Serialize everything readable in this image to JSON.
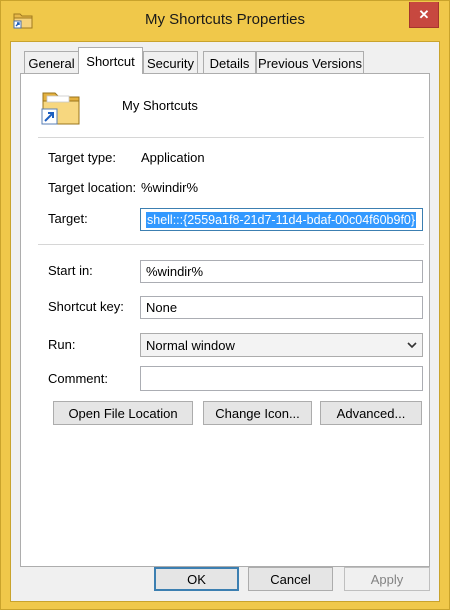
{
  "window": {
    "title": "My Shortcuts Properties",
    "close_glyph": "✕"
  },
  "tabs": [
    {
      "label": "General"
    },
    {
      "label": "Shortcut"
    },
    {
      "label": "Security"
    },
    {
      "label": "Details"
    },
    {
      "label": "Previous Versions"
    }
  ],
  "active_tab": "Shortcut",
  "shortcut": {
    "name": "My Shortcuts",
    "target_type_label": "Target type:",
    "target_type_value": "Application",
    "target_location_label": "Target location:",
    "target_location_value": "%windir%",
    "target_label": "Target:",
    "target_value": "shell:::{2559a1f8-21d7-11d4-bdaf-00c04f60b9f0}",
    "start_in_label": "Start in:",
    "start_in_value": "%windir%",
    "shortcut_key_label": "Shortcut key:",
    "shortcut_key_value": "None",
    "run_label": "Run:",
    "run_value": "Normal window",
    "comment_label": "Comment:",
    "comment_value": "",
    "open_file_location_label": "Open File Location",
    "change_icon_label": "Change Icon...",
    "advanced_label": "Advanced..."
  },
  "footer": {
    "ok_label": "OK",
    "cancel_label": "Cancel",
    "apply_label": "Apply"
  },
  "icons": {
    "title": "folder-shortcut-icon",
    "shortcut": "folder-shortcut-icon",
    "close": "close-icon",
    "dropdown": "chevron-down-icon"
  },
  "colors": {
    "frame": "#f0c84a",
    "close_button": "#c7483f",
    "selection": "#3399ff"
  }
}
